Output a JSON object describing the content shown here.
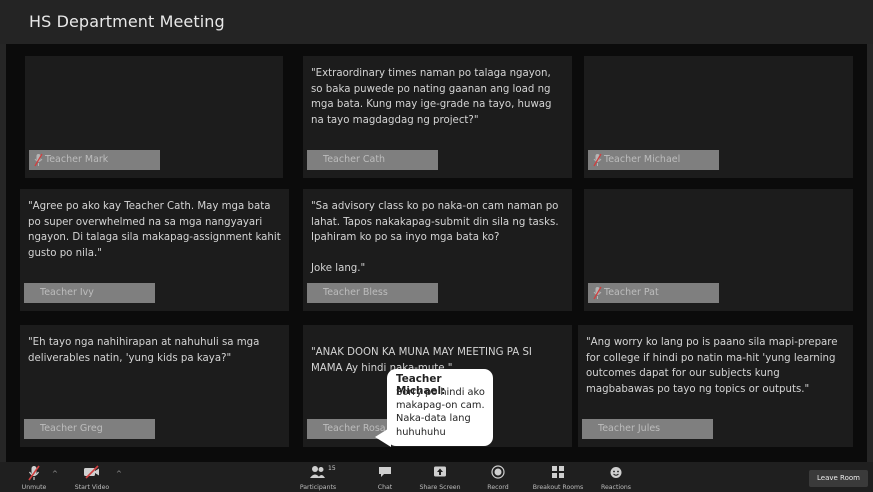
{
  "window": {
    "title": "HS Department Meeting"
  },
  "tiles": [
    {
      "name": "Teacher Mark",
      "quote": "",
      "mic_muted": true
    },
    {
      "name": "Teacher Cath",
      "quote": "\"Extraordinary times naman po talaga ngayon, so baka puwede po nating gaanan ang load ng mga bata. Kung may ige-grade na tayo, huwag na tayo magdagdag ng project?\"",
      "mic_muted": false
    },
    {
      "name": "Teacher Michael",
      "quote": "",
      "mic_muted": true
    },
    {
      "name": "Teacher Ivy",
      "quote": "\"Agree po ako kay Teacher Cath. May mga bata po super overwhelmed na sa mga nangyayari ngayon. Di talaga sila makapag-assignment kahit gusto po nila.\"",
      "mic_muted": false
    },
    {
      "name": "Teacher Bless",
      "quote": "\"Sa advisory class ko po naka-on cam naman po lahat. Tapos nakakapag-submit din sila ng tasks. Ipahiram ko po sa inyo mga bata ko?\n\nJoke lang.\"",
      "mic_muted": false
    },
    {
      "name": "Teacher Pat",
      "quote": "",
      "mic_muted": true
    },
    {
      "name": "Teacher Greg",
      "quote": "\"Eh tayo nga nahihirapan at nahuhuli sa mga deliverables natin, 'yung kids pa kaya?\"",
      "mic_muted": false
    },
    {
      "name": "Teacher Rosa",
      "quote": "\"ANAK DOON KA MUNA MAY MEETING PA SI MAMA Ay hindi naka-mute.\"",
      "mic_muted": false
    },
    {
      "name": "Teacher Jules",
      "quote": "\"Ang worry ko lang po is paano sila mapi-prepare for college if hindi po natin ma-hit 'yung learning outcomes dapat for our subjects kung magbabawas po tayo ng topics or outputs.\"",
      "mic_muted": false
    }
  ],
  "chat_bubble": {
    "sender": "Teacher Michael:",
    "message": "Sorry po hindi ako makapag-on cam. Naka-data lang huhuhuhu"
  },
  "toolbar": {
    "unmute": "Unmute",
    "start_video": "Start Video",
    "participants": "Participants",
    "participants_count": "15",
    "chat": "Chat",
    "share_screen": "Share Screen",
    "record": "Record",
    "breakout_rooms": "Breakout Rooms",
    "reactions": "Reactions",
    "leave_room": "Leave Room"
  },
  "colors": {
    "background": "#0b0b0b",
    "tile": "#1c1c1c",
    "namebar": "#7f7f7f",
    "toolbar": "#1f1f1f",
    "bubble": "#ffffff"
  }
}
